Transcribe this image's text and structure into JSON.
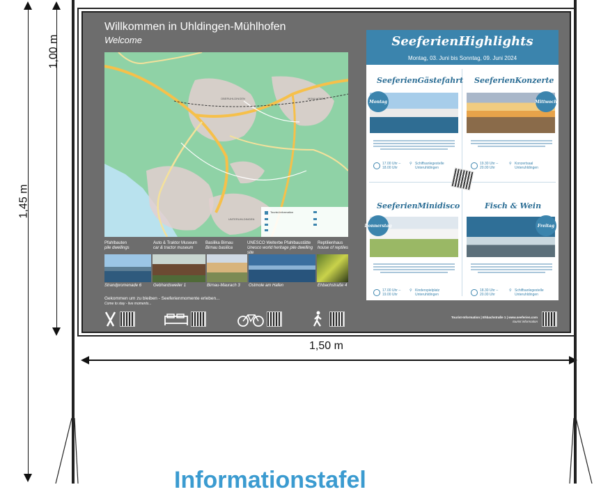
{
  "dimensions": {
    "height_top": "1,00 m",
    "height_total": "1,45 m",
    "width": "1,50 m"
  },
  "board": {
    "title": "Willkommen in Uhldingen-Mühlhofen",
    "subtitle": "Welcome",
    "map_labels": {
      "oberuhldingen": "OBERUHLDINGEN",
      "muehlhofen": "MÜHLHOFEN",
      "unteruhldingen": "UNTERUHLDINGEN",
      "legend_title": "Tourist-Information"
    },
    "attractions": [
      {
        "de": "Pfahlbauten",
        "en": "pile dwellings"
      },
      {
        "de": "Auto & Traktor Museum",
        "en": "car & tractor museum"
      },
      {
        "de": "Basilika Birnau",
        "en": "Birnau basilica"
      },
      {
        "de": "UNESCO Welterbe Pfahlbaustätte",
        "en": "Unesco world heritage pile dwelling site"
      },
      {
        "de": "Reptilienhaus",
        "en": "house of reptiles"
      }
    ],
    "photo_captions": [
      "Strandpromenade 6",
      "Gebhardsweiler 1",
      "Birnau-Maurach 3",
      "Ostmole am Hafen",
      "Ehbachstraße 4"
    ],
    "slogan": "Gekommen um zu bleiben - Seeferienmomente erleben...",
    "slogan_en": "Come to stay - live moments...",
    "icons": [
      "cutlery-icon",
      "bed-icon",
      "bicycle-icon",
      "hiker-icon"
    ],
    "footer_line1": "Tourist-Information | Ehbachstraße 1 | www.seeferien.com",
    "footer_line2": "tourist information"
  },
  "poster": {
    "title": "SeeferienHighlights",
    "dates": "Montag, 03. Juni bis Sonntag, 09. Juni 2024",
    "events": [
      {
        "name": "SeeferienGästefahrt",
        "day": "Montag",
        "time1": "17.00 Uhr –",
        "time2": "18.00 Uhr",
        "place1": "Schiffsanlegestelle",
        "place2": "Unteruhldingen"
      },
      {
        "name": "SeeferienKonzerte",
        "day": "Mittwoch",
        "time1": "19.30 Uhr –",
        "time2": "20.00 Uhr",
        "place1": "Konzertsaal",
        "place2": "Unteruhldingen"
      },
      {
        "name": "SeeferienMinidisco",
        "day": "Donnerstag",
        "time1": "17.00 Uhr –",
        "time2": "19.00 Uhr",
        "place1": "Kinderspielplatz",
        "place2": "Unteruhldingen"
      },
      {
        "name": "Fisch & Wein",
        "day": "Freitag",
        "time1": "18.30 Uhr –",
        "time2": "20.00 Uhr",
        "place1": "Schiffsanlegestelle",
        "place2": "Unteruhldingen"
      }
    ]
  },
  "bottom_heading": "Informationstafel",
  "colors": {
    "board_bg": "#6d6d6d",
    "poster_blue": "#3b84ad",
    "map_green": "#8fd2a6",
    "heading_blue": "#3b9bd0"
  }
}
